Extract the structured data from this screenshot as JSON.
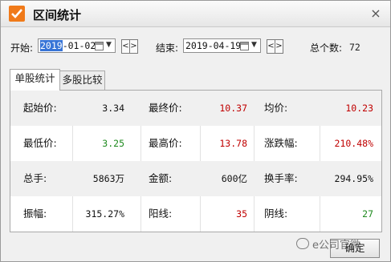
{
  "window": {
    "title": "区间统计",
    "close": "×"
  },
  "toolbar": {
    "start_label": "开始:",
    "start_date_sel": "2019",
    "start_date_rest": "-01-02",
    "end_label": "结束:",
    "end_date": "2019-04-19",
    "prev": "<",
    "next": ">",
    "count_label": "总个数:",
    "count_value": "72"
  },
  "tabs": [
    {
      "label": "单股统计",
      "active": true
    },
    {
      "label": "多股比较",
      "active": false
    }
  ],
  "stats": {
    "rows": [
      [
        {
          "label": "起始价:",
          "value": "3.34",
          "color": "#111111"
        },
        {
          "label": "最终价:",
          "value": "10.37",
          "color": "#c00000"
        },
        {
          "label": "均价:",
          "value": "10.23",
          "color": "#c00000"
        }
      ],
      [
        {
          "label": "最低价:",
          "value": "3.25",
          "color": "#1e8a1e"
        },
        {
          "label": "最高价:",
          "value": "13.78",
          "color": "#c00000"
        },
        {
          "label": "涨跌幅:",
          "value": "210.48%",
          "color": "#c00000"
        }
      ],
      [
        {
          "label": "总手:",
          "value": "5863万",
          "color": "#111111"
        },
        {
          "label": "金额:",
          "value": "600亿",
          "color": "#111111"
        },
        {
          "label": "换手率:",
          "value": "294.95%",
          "color": "#111111"
        }
      ],
      [
        {
          "label": "振幅:",
          "value": "315.27%",
          "color": "#111111"
        },
        {
          "label": "阳线:",
          "value": "35",
          "color": "#c00000"
        },
        {
          "label": "阴线:",
          "value": "27",
          "color": "#1e8a1e"
        }
      ]
    ]
  },
  "footer": {
    "ok_label": "确定",
    "watermark": "e公司官微"
  },
  "icons": {
    "app": "check-icon",
    "calendar": "calendar-icon",
    "dropdown": "chevron-down-icon"
  },
  "colors": {
    "up": "#c00000",
    "down": "#1e8a1e",
    "selection": "#3875d7",
    "app_icon": "#f07a1a"
  }
}
